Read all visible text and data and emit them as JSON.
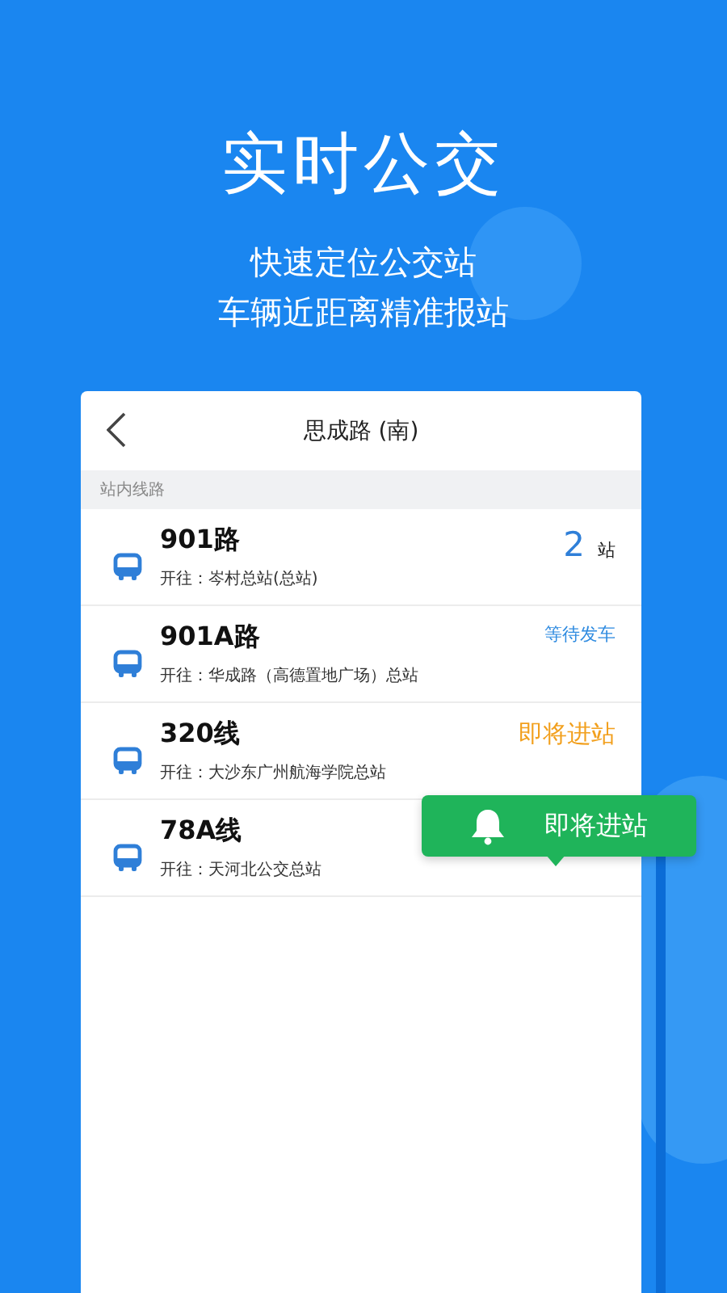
{
  "headline": "实时公交",
  "taglines": [
    "快速定位公交站",
    "车辆近距离精准报站"
  ],
  "card": {
    "title": "思成路 (南)",
    "section_label": "站内线路",
    "routes": [
      {
        "name": "901路",
        "destination": "开往：岑村总站(总站)",
        "kind": "stops",
        "count": "2",
        "unit": "站"
      },
      {
        "name": "901A路",
        "destination": "开往：华成路（高德置地广场）总站",
        "kind": "waiting",
        "status": "等待发车"
      },
      {
        "name": "320线",
        "destination": "开往：大沙东广州航海学院总站",
        "kind": "arriving",
        "status": "即将进站"
      },
      {
        "name": "78A线",
        "destination": "开往：天河北公交总站",
        "kind": "none"
      }
    ]
  },
  "toast": {
    "text": "即将进站"
  }
}
